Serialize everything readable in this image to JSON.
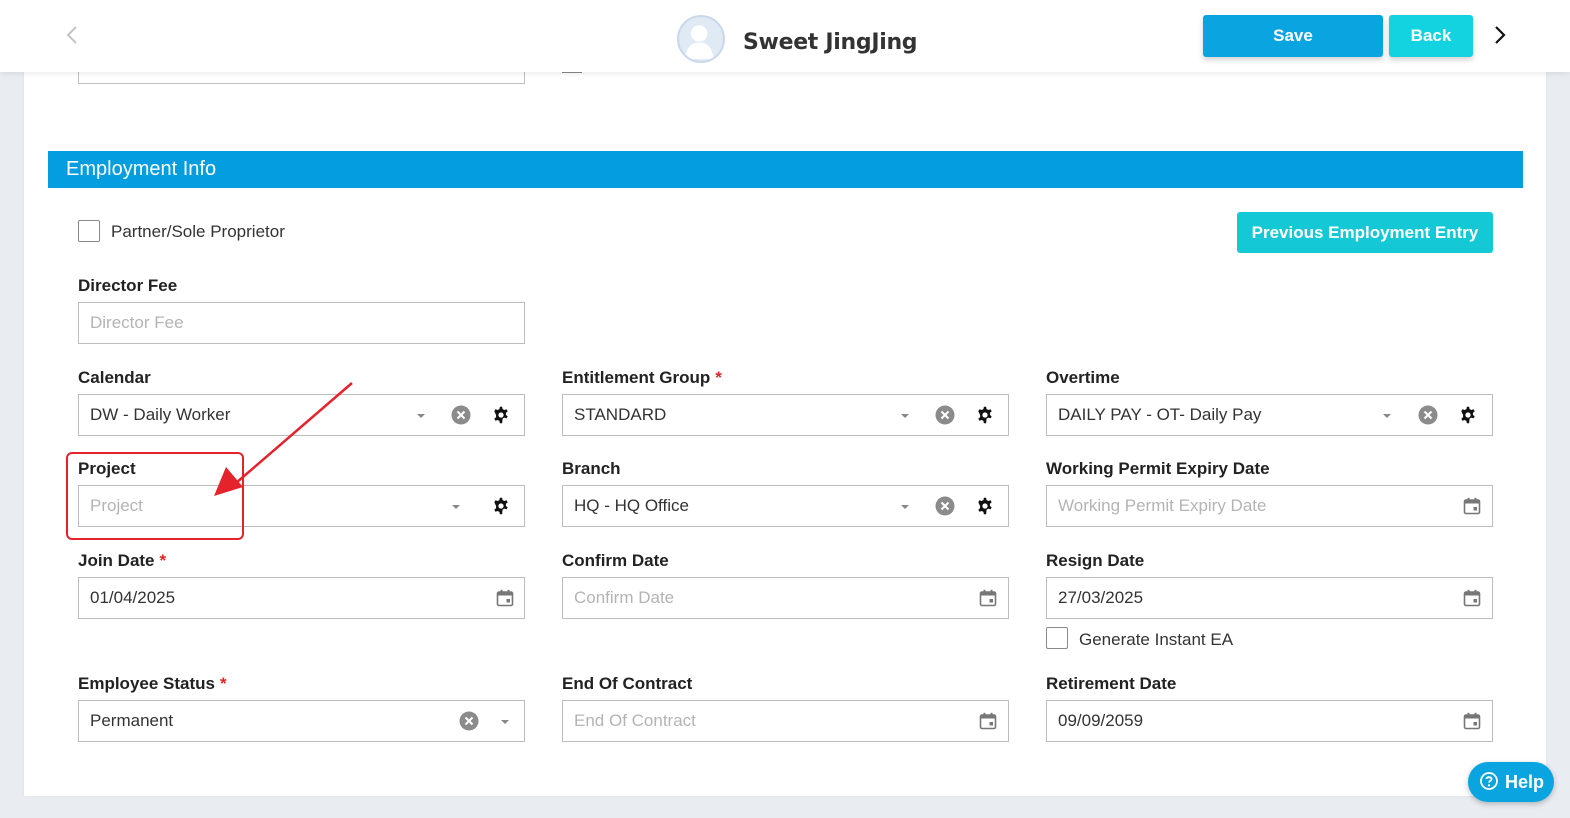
{
  "header": {
    "employee_name": "Sweet JingJing",
    "save_label": "Save",
    "back_label": "Back"
  },
  "section": {
    "title": "Employment Info",
    "previous_employment_label": "Previous Employment Entry"
  },
  "partner": {
    "label": "Partner/Sole Proprietor",
    "checked": false
  },
  "director_fee": {
    "label": "Director Fee",
    "placeholder": "Director Fee",
    "value": ""
  },
  "calendar": {
    "label": "Calendar",
    "value": "DW - Daily Worker"
  },
  "entitlement_group": {
    "label": "Entitlement Group",
    "required": "*",
    "value": "STANDARD"
  },
  "overtime": {
    "label": "Overtime",
    "value": "DAILY PAY - OT- Daily Pay"
  },
  "project": {
    "label": "Project",
    "placeholder": "Project",
    "value": ""
  },
  "branch": {
    "label": "Branch",
    "value": "HQ - HQ Office"
  },
  "working_permit": {
    "label": "Working Permit Expiry Date",
    "placeholder": "Working Permit Expiry Date",
    "value": ""
  },
  "join_date": {
    "label": "Join Date",
    "required": "*",
    "value": "01/04/2025"
  },
  "confirm_date": {
    "label": "Confirm Date",
    "placeholder": "Confirm Date",
    "value": ""
  },
  "resign_date": {
    "label": "Resign Date",
    "value": "27/03/2025"
  },
  "generate_ea": {
    "label": "Generate Instant EA",
    "checked": false
  },
  "employee_status": {
    "label": "Employee Status",
    "required": "*",
    "value": "Permanent"
  },
  "end_of_contract": {
    "label": "End Of Contract",
    "placeholder": "End Of Contract",
    "value": ""
  },
  "retirement_date": {
    "label": "Retirement Date",
    "value": "09/09/2059"
  },
  "help": {
    "label": "Help"
  },
  "colors": {
    "primary": "#0aa5e1",
    "accent": "#14d3e0",
    "section_header": "#039de0",
    "required": "#e02424",
    "annotation": "#e5232c"
  }
}
